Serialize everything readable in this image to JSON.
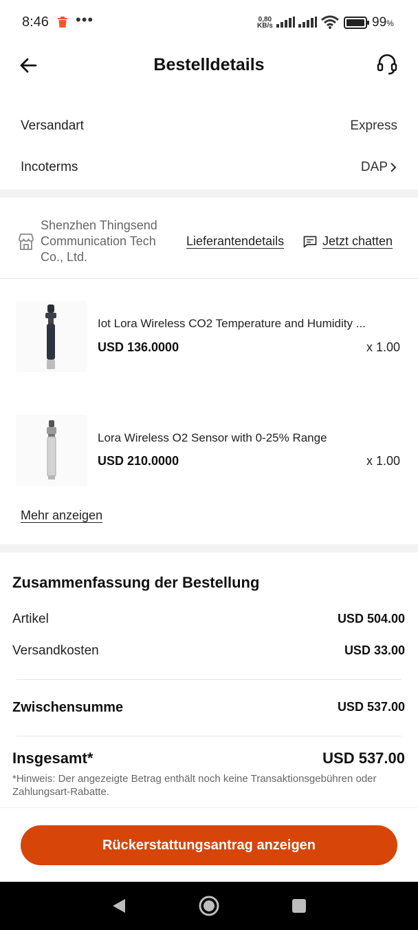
{
  "status_bar": {
    "time": "8:46",
    "network_speed_value": "0,80",
    "network_speed_unit": "KB/s",
    "battery_percent": "99",
    "battery_unit": "%"
  },
  "header": {
    "title": "Bestelldetails"
  },
  "shipping": {
    "method_label": "Versandart",
    "method_value": "Express",
    "incoterms_label": "Incoterms",
    "incoterms_value": "DAP"
  },
  "supplier": {
    "name": "Shenzhen Thingsend Communication Tech Co., Ltd.",
    "details_link": "Lieferantendetails",
    "chat_link": "Jetzt chatten"
  },
  "products": [
    {
      "title": "Iot Lora Wireless CO2 Temperature and Humidity ...",
      "price": "USD 136.0000",
      "quantity": "x 1.00"
    },
    {
      "title": "Lora Wireless O2 Sensor with 0-25% Range",
      "price": "USD 210.0000",
      "quantity": "x 1.00"
    }
  ],
  "more_link": "Mehr anzeigen",
  "summary": {
    "title": "Zusammenfassung der Bestellung",
    "items_label": "Artikel",
    "items_value": "USD 504.00",
    "shipping_label": "Versandkosten",
    "shipping_value": "USD 33.00",
    "subtotal_label": "Zwischensumme",
    "subtotal_value": "USD 537.00",
    "total_label": "Insgesamt*",
    "total_value": "USD 537.00",
    "note": "*Hinweis: Der angezeigte Betrag enthält noch keine Transaktionsgebühren oder Zahlungsart-Rabatte."
  },
  "action": {
    "refund_button": "Rückerstattungsantrag anzeigen"
  },
  "colors": {
    "accent": "#d84508",
    "notification_icon": "#ee5a2a"
  }
}
